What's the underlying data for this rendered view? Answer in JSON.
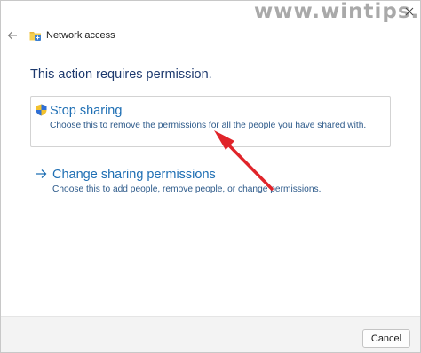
{
  "watermark": "www.wintips.org",
  "window": {
    "title": "Network access",
    "back_icon": "back-arrow-icon",
    "app_icon": "network-folder-icon",
    "close_icon": "close-icon"
  },
  "main": {
    "heading": "This action requires permission.",
    "options": [
      {
        "icon": "uac-shield-icon",
        "title": "Stop sharing",
        "description": "Choose this to remove the permissions for all the people you have shared with."
      },
      {
        "icon": "arrow-right-icon",
        "title": "Change sharing permissions",
        "description": "Choose this to add people, remove people, or change permissions."
      }
    ]
  },
  "footer": {
    "cancel_label": "Cancel"
  },
  "annotation": {
    "icon": "red-arrow-annotation",
    "color": "#e0242a"
  },
  "colors": {
    "link_blue": "#1f6fb4",
    "heading_navy": "#1e3a6e",
    "footer_bg": "#f3f3f3"
  }
}
